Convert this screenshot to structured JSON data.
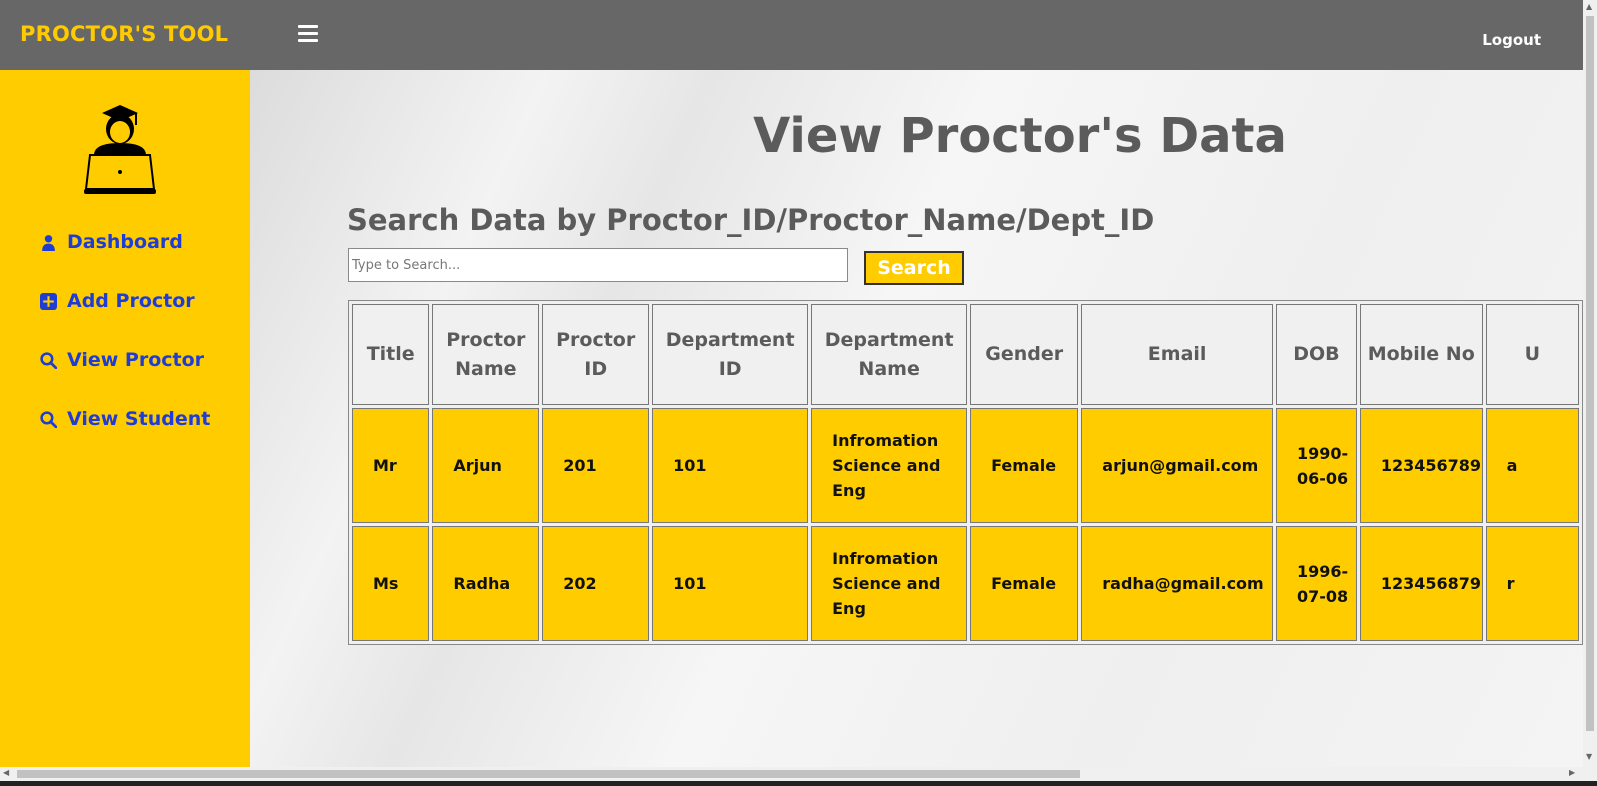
{
  "header": {
    "brand": "PROCTOR'S TOOL",
    "menu_icon": "hamburger-menu-icon",
    "logout_label": "Logout"
  },
  "sidebar": {
    "avatar_icon": "student-laptop-avatar-icon",
    "items": [
      {
        "label": "Dashboard",
        "icon": "user-icon"
      },
      {
        "label": "Add Proctor",
        "icon": "plus-square-icon"
      },
      {
        "label": "View Proctor",
        "icon": "search-icon"
      },
      {
        "label": "View Student",
        "icon": "search-icon"
      }
    ]
  },
  "main": {
    "title": "View Proctor's Data",
    "search_label": "Search Data by Proctor_ID/Proctor_Name/Dept_ID",
    "search_placeholder": "Type to Search...",
    "search_value": "",
    "search_button": "Search"
  },
  "table": {
    "headers": [
      "Title",
      "Proctor Name",
      "Proctor ID",
      "Department ID",
      "Department Name",
      "Gender",
      "Email",
      "DOB",
      "Mobile No",
      "U"
    ],
    "rows": [
      [
        "Mr",
        "Arjun",
        "201",
        "101",
        "Infromation Science and Eng",
        "Female",
        "arjun@gmail.com",
        "1990-06-06",
        "123456789",
        "a"
      ],
      [
        "Ms",
        "Radha",
        "202",
        "101",
        "Infromation Science and Eng",
        "Female",
        "radha@gmail.com",
        "1996-07-08",
        "123456879",
        "r"
      ]
    ]
  },
  "colors": {
    "accent": "#ffcc00",
    "topbar": "#676767",
    "nav_text": "#1f3dd6",
    "heading_text": "#5b5b5b"
  }
}
